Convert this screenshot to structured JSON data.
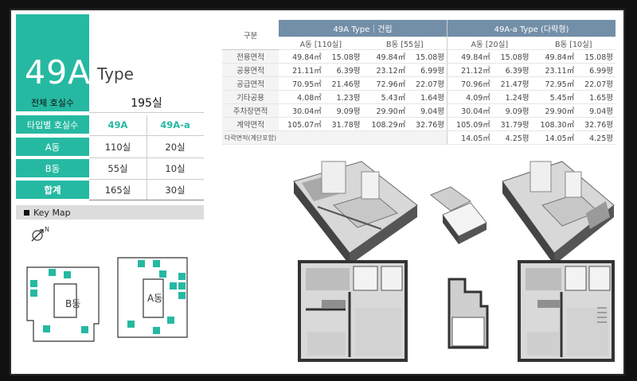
{
  "header": {
    "type_number": "49A",
    "type_word": "Type"
  },
  "summary": {
    "total_label": "전체 호실수",
    "total_value": "195실",
    "by_type_label": "타입별 호실수",
    "type_a": "49A",
    "type_a_a": "49A-a",
    "rows": [
      {
        "label": "A동",
        "a": "110실",
        "aa": "20실"
      },
      {
        "label": "B동",
        "a": "55실",
        "aa": "10실"
      },
      {
        "label": "합계",
        "a": "165실",
        "aa": "30실"
      }
    ]
  },
  "keymap": {
    "title": "Key Map",
    "building_b": "B동",
    "building_a": "A동",
    "north": "N"
  },
  "area_table": {
    "caption": "구분",
    "group1": "49A Type｜건립",
    "group2": "49A-a Type (다락형)",
    "sub": [
      "A동 [110실]",
      "B동 [55실]",
      "A동 [20실]",
      "B동 [10실]"
    ],
    "rows": [
      {
        "label": "전용면적",
        "v": [
          "49.84㎡",
          "15.08평",
          "49.84㎡",
          "15.08평",
          "49.84㎡",
          "15.08평",
          "49.84㎡",
          "15.08평"
        ]
      },
      {
        "label": "공용면적",
        "v": [
          "21.11㎡",
          "6.39평",
          "23.12㎡",
          "6.99평",
          "21.12㎡",
          "6.39평",
          "23.11㎡",
          "6.99평"
        ]
      },
      {
        "label": "공급면적",
        "v": [
          "70.95㎡",
          "21.46평",
          "72.96㎡",
          "22.07평",
          "70.96㎡",
          "21.47평",
          "72.95㎡",
          "22.07평"
        ]
      },
      {
        "label": "기타공용",
        "v": [
          "4.08㎡",
          "1.23평",
          "5.43㎡",
          "1.64평",
          "4.09㎡",
          "1.24평",
          "5.45㎡",
          "1.65평"
        ]
      },
      {
        "label": "주차장면적",
        "v": [
          "30.04㎡",
          "9.09평",
          "29.90㎡",
          "9.04평",
          "30.04㎡",
          "9.09평",
          "29.90㎡",
          "9.04평"
        ]
      },
      {
        "label": "계약면적",
        "v": [
          "105.07㎡",
          "31.78평",
          "108.29㎡",
          "32.76평",
          "105.09㎡",
          "31.79평",
          "108.30㎡",
          "32.76평"
        ]
      },
      {
        "label": "다락면적(계단포함)",
        "v": [
          "",
          "",
          "",
          "",
          "14.05㎡",
          "4.25평",
          "14.05㎡",
          "4.25평"
        ]
      }
    ]
  },
  "colors": {
    "accent": "#26b9a2",
    "table_header": "#738fa8"
  }
}
